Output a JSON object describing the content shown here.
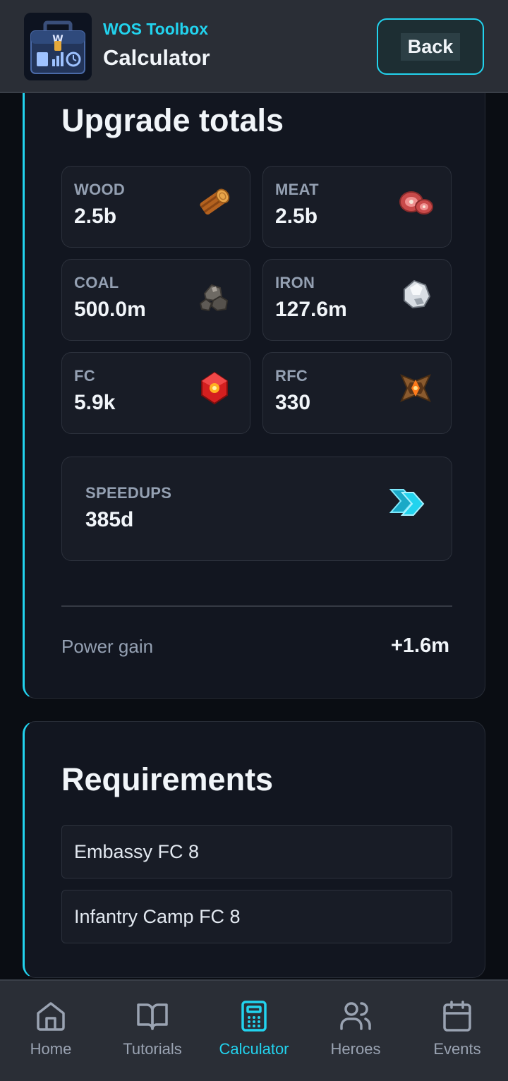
{
  "header": {
    "app_name": "WOS Toolbox",
    "page_title": "Calculator",
    "back_label": "Back"
  },
  "upgrade_totals": {
    "title": "Upgrade totals",
    "resources": [
      {
        "label": "WOOD",
        "value": "2.5b",
        "icon": "wood-log-icon"
      },
      {
        "label": "MEAT",
        "value": "2.5b",
        "icon": "meat-icon"
      },
      {
        "label": "COAL",
        "value": "500.0m",
        "icon": "coal-icon"
      },
      {
        "label": "IRON",
        "value": "127.6m",
        "icon": "iron-ore-icon"
      },
      {
        "label": "FC",
        "value": "5.9k",
        "icon": "fire-crystal-icon"
      },
      {
        "label": "RFC",
        "value": "330",
        "icon": "refined-fire-crystal-icon"
      }
    ],
    "speedups": {
      "label": "SPEEDUPS",
      "value": "385d",
      "icon": "speedup-arrows-icon"
    },
    "power_gain": {
      "label": "Power gain",
      "value": "+1.6m"
    }
  },
  "requirements": {
    "title": "Requirements",
    "items": [
      "Embassy FC 8",
      "Infantry Camp FC 8"
    ]
  },
  "nav": {
    "items": [
      {
        "label": "Home",
        "icon": "home-icon"
      },
      {
        "label": "Tutorials",
        "icon": "book-icon"
      },
      {
        "label": "Calculator",
        "icon": "calculator-icon",
        "active": true
      },
      {
        "label": "Heroes",
        "icon": "users-icon"
      },
      {
        "label": "Events",
        "icon": "calendar-icon"
      }
    ]
  },
  "colors": {
    "accent": "#22d3ee",
    "background": "#0a0d13",
    "card": "#121620",
    "tile": "#181c26"
  }
}
